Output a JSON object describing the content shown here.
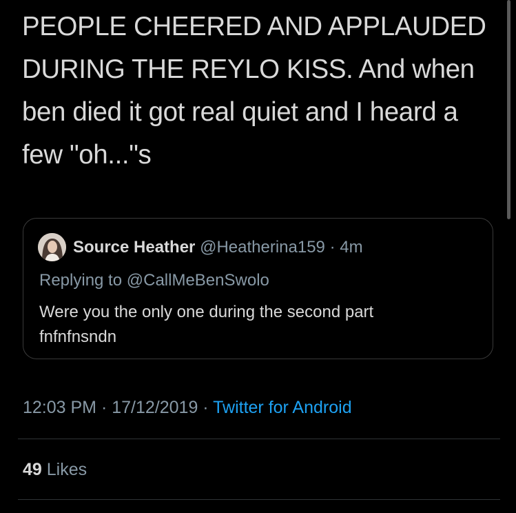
{
  "tweet": {
    "text_lines": [
      "PEOPLE CHEERED AND APPLAUDED",
      "DURING THE REYLO KISS. And when",
      "ben died it got real quiet and I heard a",
      "few \"oh...\"s"
    ]
  },
  "quote": {
    "name": "Source Heather",
    "handle": "@Heatherina159",
    "separator": "·",
    "time": "4m",
    "replying_prefix": "Replying to ",
    "replying_handle": "@CallMeBenSwolo",
    "body_lines": [
      "Were you the only one during the second part",
      "fnfnfnsndn"
    ],
    "avatar_icon": "profile-photo"
  },
  "meta": {
    "time": "12:03 PM",
    "sep1": " · ",
    "date": "17/12/2019",
    "sep2": " · ",
    "source": "Twitter for Android"
  },
  "likes": {
    "count": "49",
    "label": "Likes"
  },
  "colors": {
    "background": "#000000",
    "text": "#d9d9d9",
    "secondary": "#8899a6",
    "link": "#1da1f2",
    "border": "#3a3a3a"
  }
}
